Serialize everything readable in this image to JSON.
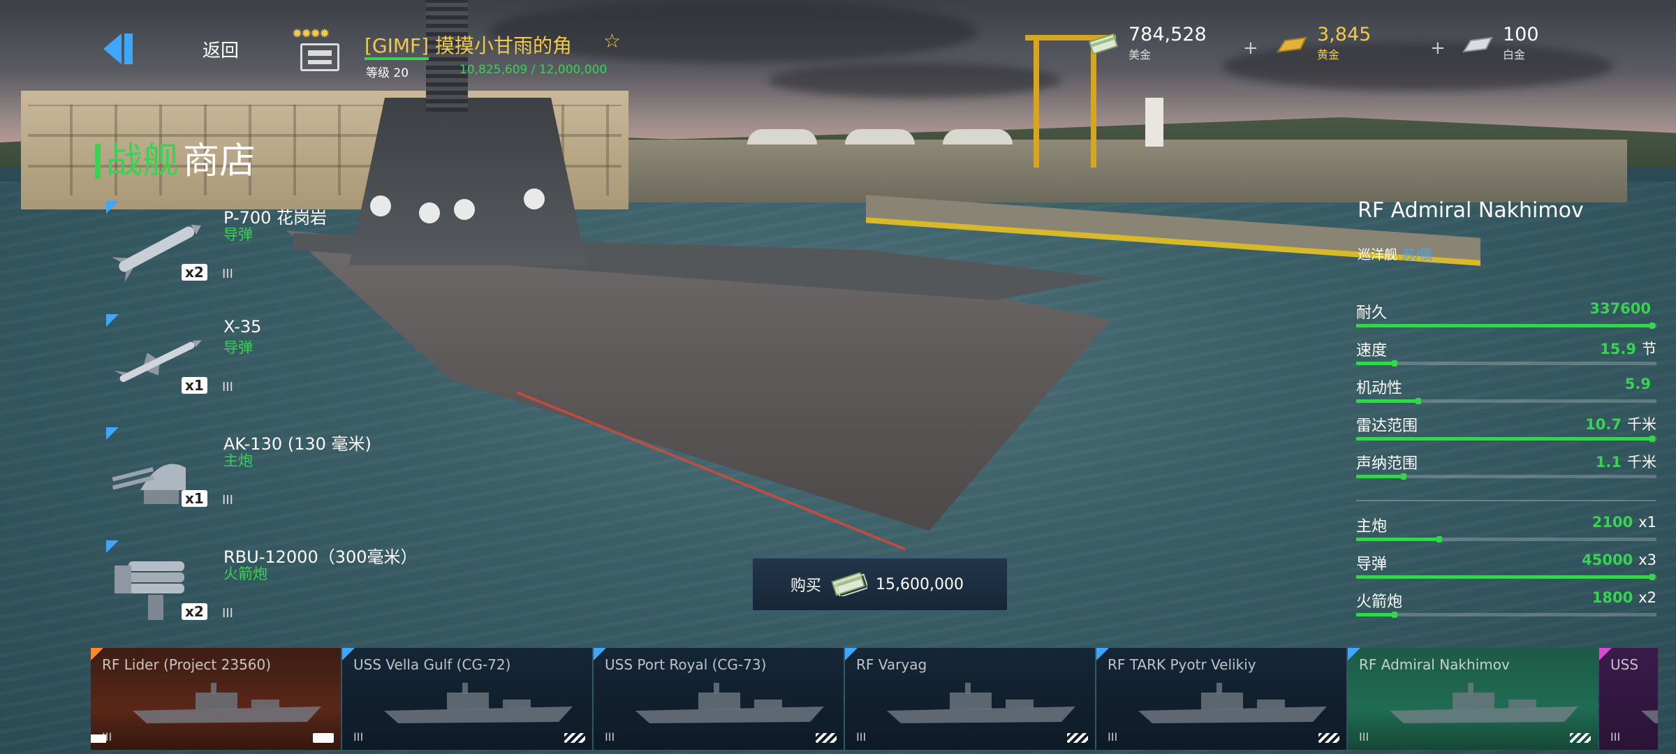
{
  "colors": {
    "accent_green": "#39d353",
    "accent_blue": "#3ea6ff",
    "gold": "#f2c94c"
  },
  "header": {
    "back_label": "返回",
    "player": {
      "clan": "[GIMF]",
      "name": "摸摸小甘雨的角",
      "level": "等级 20",
      "xp": "10,825,609 / 12,000,000",
      "rank_stars": "✹✹✹✹"
    },
    "currencies": [
      {
        "icon": "cash-icon",
        "value": "784,528",
        "label": "美金"
      },
      {
        "icon": "gold-bar-icon",
        "value": "3,845",
        "label": "黄金"
      },
      {
        "icon": "platinum-bar-icon",
        "value": "100",
        "label": "白金"
      }
    ],
    "plus": "+"
  },
  "page_title": {
    "category": "战舰",
    "section": "商店"
  },
  "weapons": [
    {
      "name": "P-700 花岗岩",
      "type": "导弹",
      "count": "x2",
      "tier": "III",
      "icon": "heavy-missile-icon"
    },
    {
      "name": "X-35",
      "type": "导弹",
      "count": "x1",
      "tier": "III",
      "icon": "missile-icon"
    },
    {
      "name": "AK-130 (130 毫米)",
      "type": "主炮",
      "count": "x1",
      "tier": "III",
      "icon": "gun-turret-icon"
    },
    {
      "name": "RBU-12000（300毫米）",
      "type": "火箭炮",
      "count": "x2",
      "tier": "III",
      "icon": "rocket-launcher-icon"
    }
  ],
  "ship": {
    "name": "RF Admiral Nakhimov",
    "class": "巡洋舰",
    "class_tag": "苏/俄"
  },
  "stats": [
    {
      "label": "耐久",
      "value": "337600",
      "unit": "",
      "level": 1.0
    },
    {
      "label": "速度",
      "value": "15.9",
      "unit": "节",
      "level": 0.13
    },
    {
      "label": "机动性",
      "value": "5.9",
      "unit": "",
      "level": 0.21
    },
    {
      "label": "雷达范围",
      "value": "10.7",
      "unit": "千米",
      "level": 1.0
    },
    {
      "label": "声纳范围",
      "value": "1.1",
      "unit": "千米",
      "level": 0.16
    }
  ],
  "weapon_stats": [
    {
      "label": "主炮",
      "value": "2100",
      "unit": "x1",
      "level": 0.28
    },
    {
      "label": "导弹",
      "value": "45000",
      "unit": "x3",
      "level": 1.0
    },
    {
      "label": "火箭炮",
      "value": "1800",
      "unit": "x2",
      "level": 0.13
    }
  ],
  "buy": {
    "label": "购买",
    "price": "15,600,000",
    "icon": "cash-icon"
  },
  "carousel": [
    {
      "name": "RF Lider (Project 23560)",
      "tier": "III",
      "style": "orange"
    },
    {
      "name": "USS Vella Gulf (CG-72)",
      "tier": "III",
      "style": ""
    },
    {
      "name": "USS Port Royal (CG-73)",
      "tier": "III",
      "style": ""
    },
    {
      "name": "RF Varyag",
      "tier": "III",
      "style": ""
    },
    {
      "name": "RF TARK Pyotr Velikiy",
      "tier": "III",
      "style": ""
    },
    {
      "name": "RF Admiral Nakhimov",
      "tier": "III",
      "style": "selected"
    },
    {
      "name": "USS",
      "tier": "III",
      "style": "partial"
    }
  ]
}
